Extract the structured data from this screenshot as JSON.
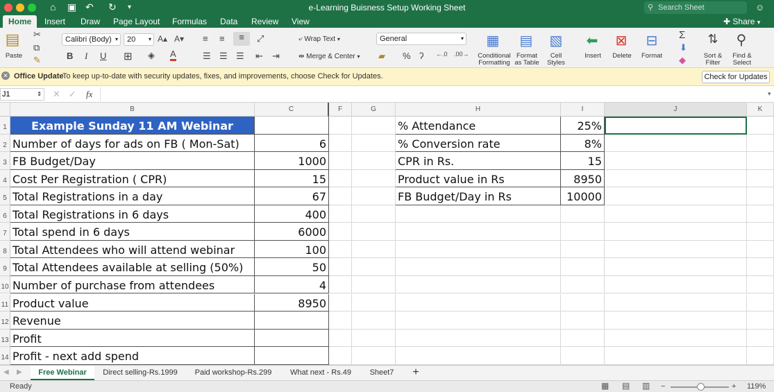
{
  "window": {
    "title": "e-Learning Buisness Setup Working Sheet",
    "search_placeholder": "Search Sheet"
  },
  "ribbon_tabs": [
    "Home",
    "Insert",
    "Draw",
    "Page Layout",
    "Formulas",
    "Data",
    "Review",
    "View"
  ],
  "share_label": "Share",
  "ribbon": {
    "paste_label": "Paste",
    "font_name": "Calibri (Body)",
    "font_size": "20",
    "wrap_text": "Wrap Text",
    "merge_center": "Merge & Center",
    "number_format": "General",
    "conditional_formatting": [
      "Conditional",
      "Formatting"
    ],
    "format_as_table": [
      "Format",
      "as Table"
    ],
    "cell_styles": [
      "Cell",
      "Styles"
    ],
    "insert": "Insert",
    "delete": "Delete",
    "format": "Format",
    "sort_filter": [
      "Sort &",
      "Filter"
    ],
    "find_select": [
      "Find &",
      "Select"
    ],
    "bold": "B",
    "italic": "I",
    "underline": "U",
    "percent": "%",
    "comma": "ʔ"
  },
  "update_bar": {
    "title": "Office Update",
    "message": "To keep up-to-date with security updates, fixes, and improvements, choose Check for Updates.",
    "button": "Check for Updates"
  },
  "formula_bar": {
    "name_box": "J1",
    "fx": "fx",
    "value": ""
  },
  "columns": [
    "B",
    "C",
    "F",
    "G",
    "H",
    "I",
    "J",
    "K"
  ],
  "rows": [
    "1",
    "2",
    "3",
    "4",
    "5",
    "6",
    "7",
    "8",
    "9",
    "10",
    "11",
    "12",
    "13",
    "14"
  ],
  "cells": {
    "B": [
      "Example Sunday 11 AM Webinar",
      "Number of days for ads on FB ( Mon-Sat)",
      "FB Budget/Day",
      "Cost Per Registration ( CPR)",
      "Total Registrations in a day",
      "Total Registrations in 6 days",
      "Total spend in 6 days",
      "Total Attendees who will attend webinar",
      "Total Attendees available at selling (50%)",
      "Number of purchase from attendees",
      "Product value",
      "Revenue",
      "Profit",
      "Profit - next add spend"
    ],
    "C": [
      "",
      "6",
      "1000",
      "15",
      "67",
      "400",
      "6000",
      "100",
      "50",
      "4",
      "8950",
      "",
      "",
      ""
    ],
    "H": [
      "% Attendance",
      "% Conversion rate",
      "CPR in Rs.",
      "Product value in Rs",
      "FB Budget/Day in Rs"
    ],
    "I": [
      "25%",
      "8%",
      "15",
      "8950",
      "10000"
    ]
  },
  "sheet_tabs": [
    "Free Webinar",
    "Direct selling-Rs.1999",
    "Paid workshop-Rs.299",
    "What next - Rs.49",
    "Sheet7"
  ],
  "add_sheet": "+",
  "status": {
    "ready": "Ready",
    "zoom": "119%",
    "minus": "−",
    "plus": "+"
  },
  "colors": {
    "excel_green": "#1e7145",
    "title_cell_blue": "#2f63c3",
    "update_bar": "#fdf4c9"
  }
}
